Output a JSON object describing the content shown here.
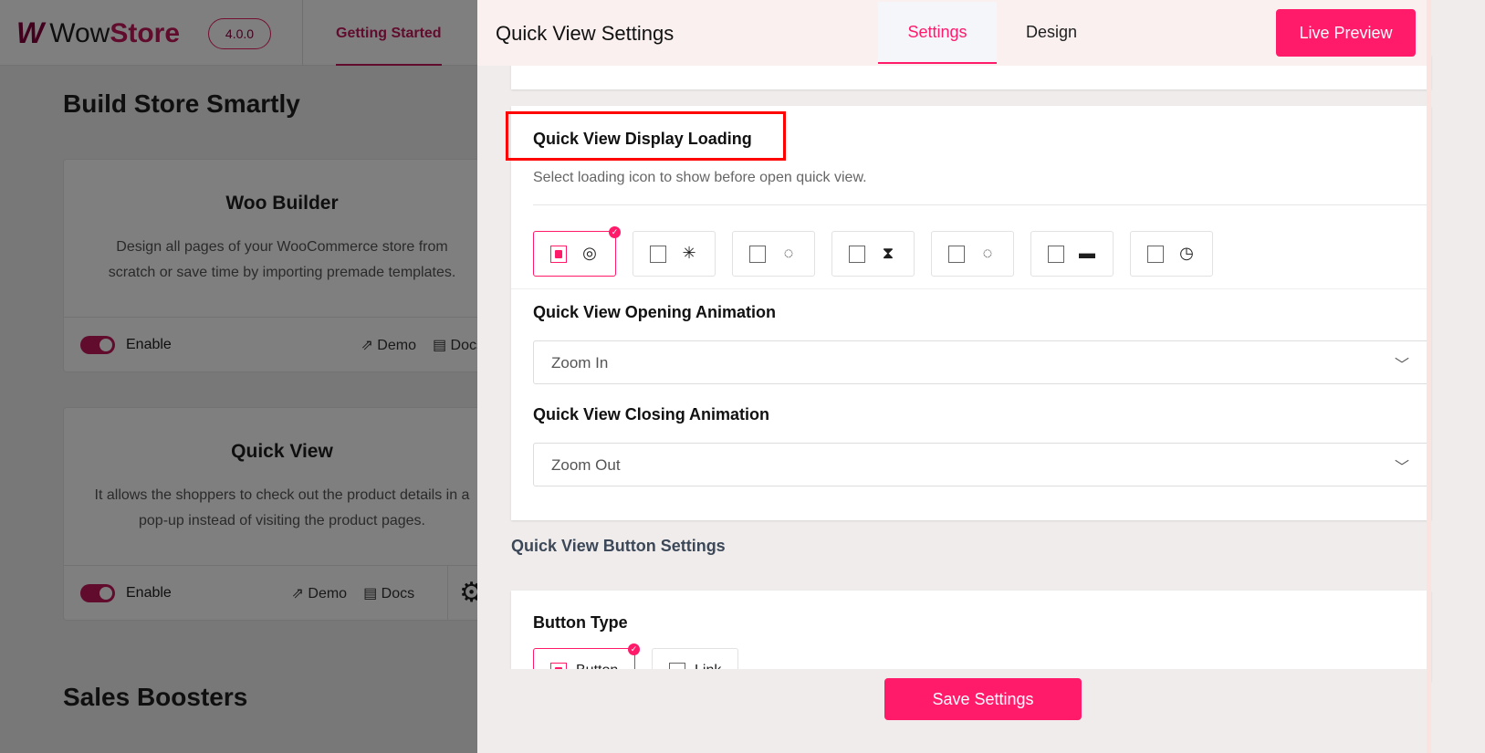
{
  "background": {
    "brand": {
      "logo_text_a": "Wow",
      "logo_text_b": "Store",
      "version": "4.0.0"
    },
    "nav": {
      "active_tab": "Getting Started"
    },
    "section_title": "Build Store Smartly",
    "cards": [
      {
        "title": "Woo Builder",
        "description": "Design all pages of your WooCommerce store from scratch or save time by importing premade templates.",
        "enable_label": "Enable",
        "demo_label": "Demo",
        "docs_label": "Docs",
        "enabled": true
      },
      {
        "title": "Quick View",
        "description": "It allows the shoppers to check out the product details in a pop-up instead of visiting the product pages.",
        "enable_label": "Enable",
        "demo_label": "Demo",
        "docs_label": "Docs",
        "enabled": true
      }
    ],
    "section_title_2": "Sales Boosters"
  },
  "panel": {
    "title": "Quick View Settings",
    "tabs": [
      {
        "label": "Settings",
        "active": true
      },
      {
        "label": "Design",
        "active": false
      }
    ],
    "live_preview_label": "Live Preview",
    "display_loading": {
      "label": "Quick View Display Loading",
      "description": "Select loading icon to show before open quick view.",
      "options": [
        "loader-1",
        "loader-2",
        "loader-3",
        "hourglass",
        "loader-5",
        "bar-loader",
        "clock"
      ],
      "selected_index": 0
    },
    "opening_animation": {
      "label": "Quick View Opening Animation",
      "value": "Zoom In"
    },
    "closing_animation": {
      "label": "Quick View Closing Animation",
      "value": "Zoom Out"
    },
    "button_settings_heading": "Quick View Button Settings",
    "button_type": {
      "label": "Button Type",
      "options": [
        "Button",
        "Link"
      ],
      "selected": "Button"
    },
    "save_label": "Save Settings"
  },
  "colors": {
    "accent": "#ff1a6a",
    "brand": "#c2185b",
    "highlight": "#ff0000"
  }
}
